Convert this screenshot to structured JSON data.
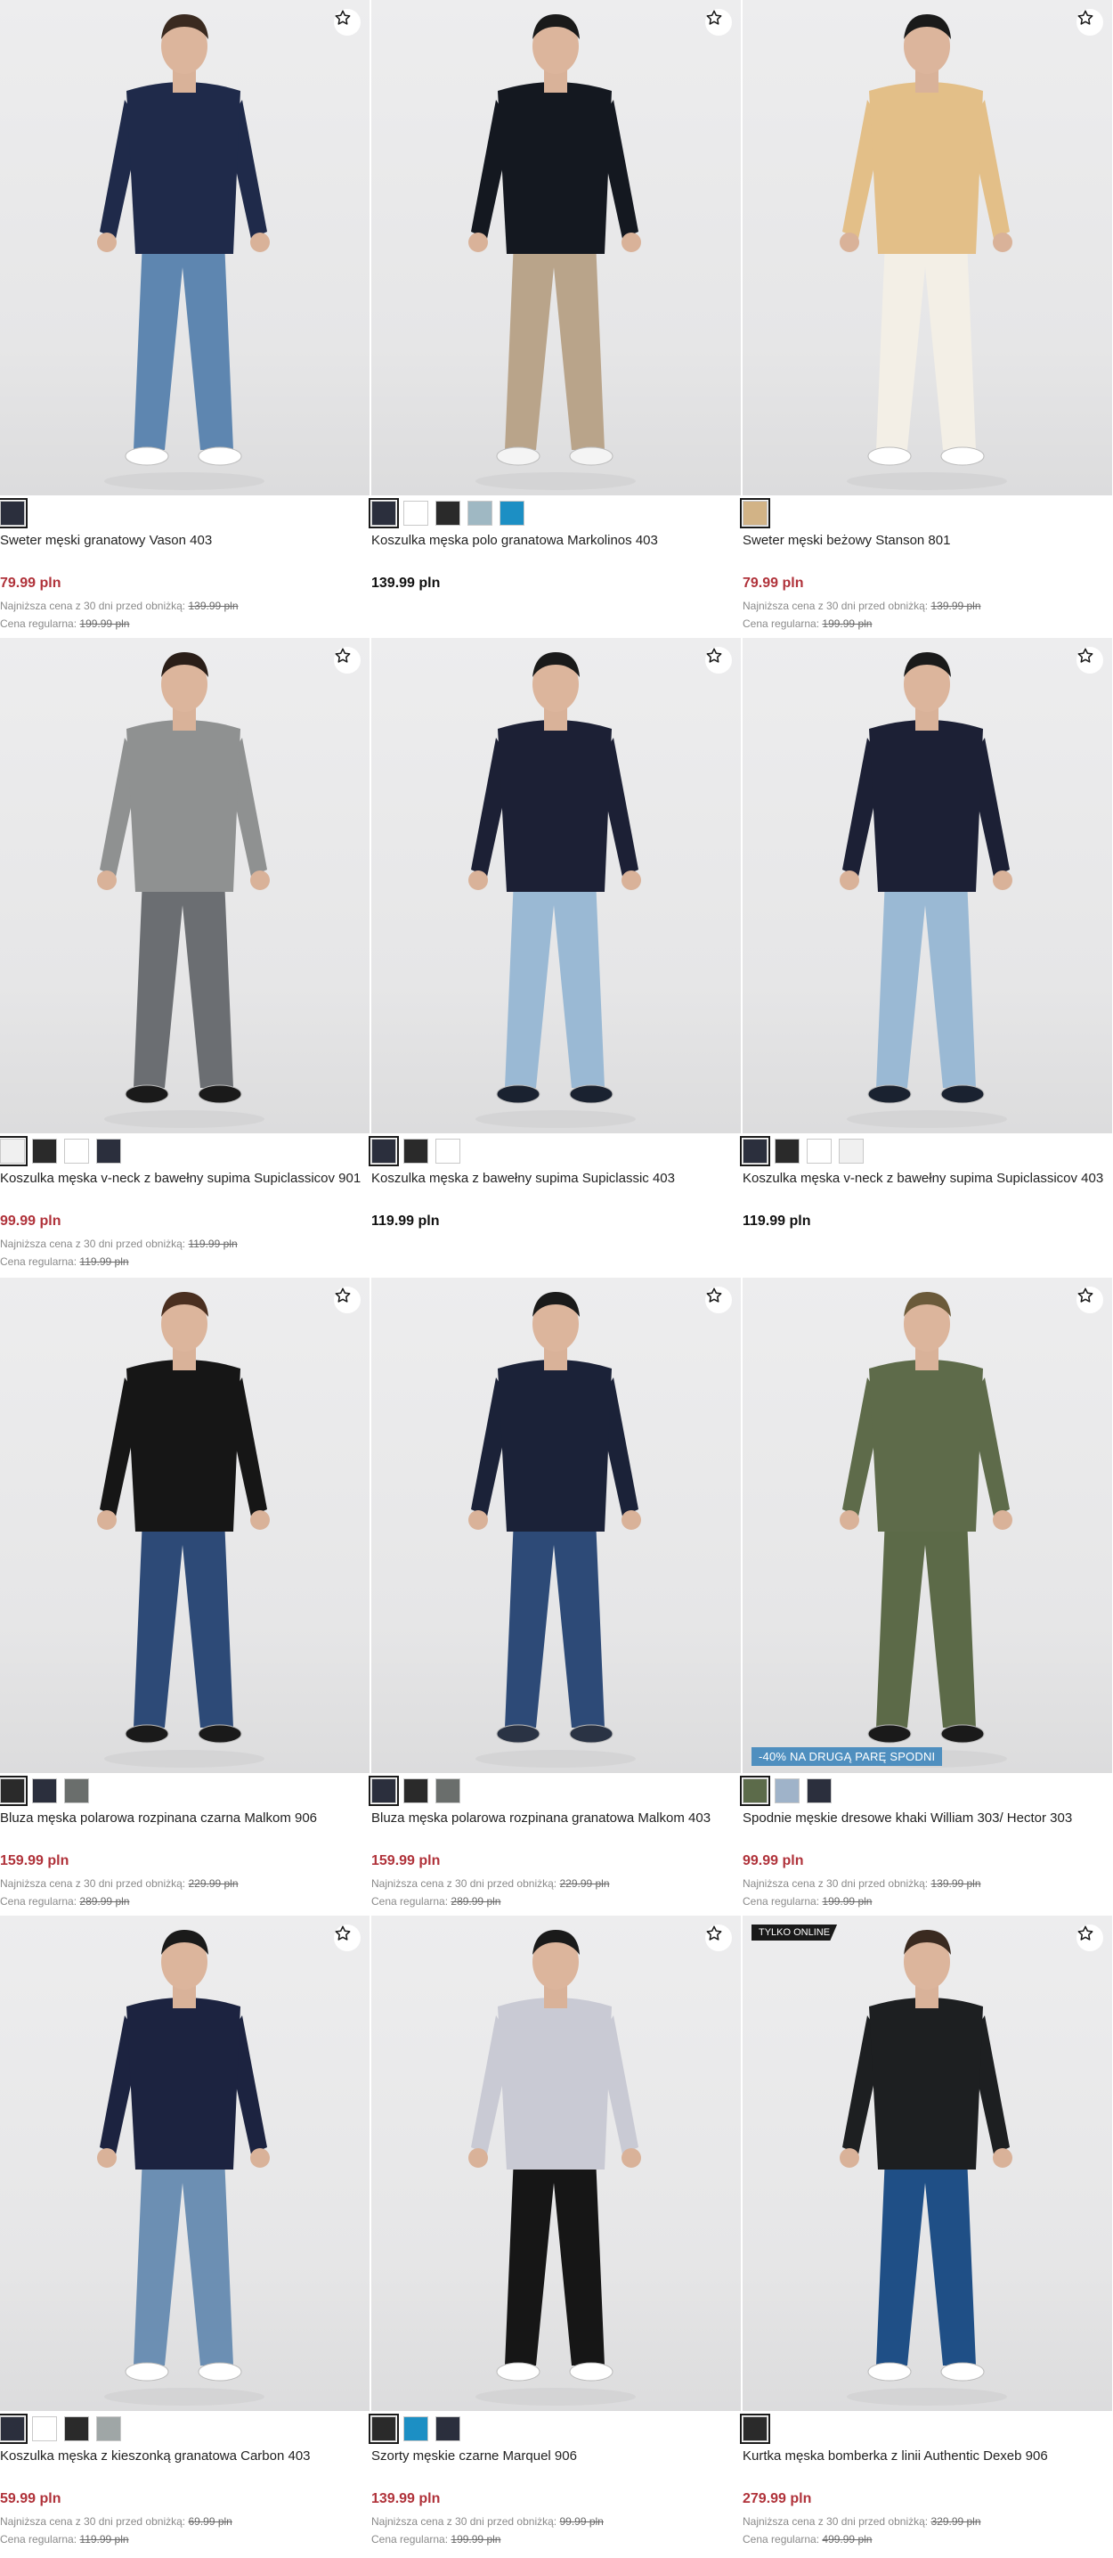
{
  "products": [
    {
      "name": "Sweter męski granatowy Vason 403",
      "price": "79.99 pln",
      "sale": true,
      "lowest_label": "Najniższa cena z 30 dni przed obniżką:",
      "lowest_value": "139.99 pln",
      "regular_label": "Cena regularna:",
      "regular_value": "199.99 pln",
      "swatches": [
        "#2b2f3d"
      ],
      "figure": {
        "top": "#1f2a4a",
        "bottom": "#5e86b0",
        "shoe": "#ffffff",
        "hair": "#3a2a20"
      }
    },
    {
      "name": "Koszulka męska polo granatowa Markolinos 403",
      "price": "139.99 pln",
      "sale": false,
      "swatches": [
        "#2b2f3d",
        "#ffffff",
        "#2a2a2a",
        "#9fb8c3",
        "#1c8fc4"
      ],
      "figure": {
        "top": "#141820",
        "bottom": "#b9a48a",
        "shoe": "#f4f4f4",
        "hair": "#1a1a1a"
      }
    },
    {
      "name": "Sweter męski beżowy Stanson 801",
      "price": "79.99 pln",
      "sale": true,
      "lowest_label": "Najniższa cena z 30 dni przed obniżką:",
      "lowest_value": "139.99 pln",
      "regular_label": "Cena regularna:",
      "regular_value": "199.99 pln",
      "swatches": [
        "#d2b386"
      ],
      "figure": {
        "top": "#e3bf88",
        "bottom": "#f3efe6",
        "shoe": "#ffffff",
        "hair": "#1a1a1a"
      }
    },
    {
      "name": "Koszulka męska v-neck z bawełny supima Supiclassicov 901",
      "price": "99.99 pln",
      "sale": true,
      "lowest_label": "Najniższa cena z 30 dni przed obniżką:",
      "lowest_value": "119.99 pln",
      "regular_label": "Cena regularna:",
      "regular_value": "119.99 pln",
      "swatches": [
        "#f0f0f0",
        "#2a2a2a",
        "#ffffff",
        "#2b2f3d"
      ],
      "figure": {
        "top": "#8f9191",
        "bottom": "#6b6e72",
        "shoe": "#1a1a1a",
        "hair": "#2a1e18"
      }
    },
    {
      "name": "Koszulka męska z bawełny supima Supiclassic 403",
      "price": "119.99 pln",
      "sale": false,
      "swatches": [
        "#2b2f3d",
        "#2a2a2a",
        "#ffffff"
      ],
      "figure": {
        "top": "#1c2035",
        "bottom": "#9ab9d4",
        "shoe": "#1a2230",
        "hair": "#1a1a1a"
      }
    },
    {
      "name": "Koszulka męska v-neck z bawełny supima Supiclassicov 403",
      "price": "119.99 pln",
      "sale": false,
      "swatches": [
        "#2b2f3d",
        "#2a2a2a",
        "#ffffff",
        "#f0f0f0"
      ],
      "figure": {
        "top": "#1c2035",
        "bottom": "#9ab9d4",
        "shoe": "#1a2230",
        "hair": "#1a1a1a"
      }
    },
    {
      "name": "Bluza męska polarowa rozpinana czarna Malkom 906",
      "price": "159.99 pln",
      "sale": true,
      "lowest_label": "Najniższa cena z 30 dni przed obniżką:",
      "lowest_value": "229.99 pln",
      "regular_label": "Cena regularna:",
      "regular_value": "289.99 pln",
      "swatches": [
        "#2a2a2a",
        "#2b2f3d",
        "#6a6e6c"
      ],
      "figure": {
        "top": "#161616",
        "bottom": "#2d4a77",
        "shoe": "#1a1a1a",
        "hair": "#4a2f20"
      }
    },
    {
      "name": "Bluza męska polarowa rozpinana granatowa Malkom 403",
      "price": "159.99 pln",
      "sale": true,
      "lowest_label": "Najniższa cena z 30 dni przed obniżką:",
      "lowest_value": "229.99 pln",
      "regular_label": "Cena regularna:",
      "regular_value": "289.99 pln",
      "swatches": [
        "#2b2f3d",
        "#2a2a2a",
        "#6a6e6c"
      ],
      "figure": {
        "top": "#1b2238",
        "bottom": "#2d4a77",
        "shoe": "#2a3344",
        "hair": "#1a1a1a"
      }
    },
    {
      "name": "Spodnie męskie dresowe khaki William 303/ Hector 303",
      "price": "99.99 pln",
      "sale": true,
      "lowest_label": "Najniższa cena z 30 dni przed obniżką:",
      "lowest_value": "139.99 pln",
      "regular_label": "Cena regularna:",
      "regular_value": "199.99 pln",
      "badge": "-40% NA DRUGĄ PARĘ SPODNI",
      "swatches": [
        "#5c6b4a",
        "#9fb3c9",
        "#2b2f3d"
      ],
      "figure": {
        "top": "#5e6b4a",
        "bottom": "#5c6a48",
        "shoe": "#1a1a1a",
        "hair": "#6b5a3a"
      }
    },
    {
      "name": "Koszulka męska z kieszonką granatowa Carbon 403",
      "price": "59.99 pln",
      "sale": true,
      "lowest_label": "Najniższa cena z 30 dni przed obniżką:",
      "lowest_value": "69.99 pln",
      "regular_label": "Cena regularna:",
      "regular_value": "119.99 pln",
      "swatches": [
        "#2b2f3d",
        "#ffffff",
        "#2a2a2a",
        "#9fa6a6"
      ],
      "figure": {
        "top": "#1c2340",
        "bottom": "#6c8fb3",
        "shoe": "#ffffff",
        "hair": "#1a1a1a"
      }
    },
    {
      "name": "Szorty męskie czarne Marquel 906",
      "price": "139.99 pln",
      "sale": true,
      "lowest_label": "Najniższa cena z 30 dni przed obniżką:",
      "lowest_value": "99.99 pln",
      "regular_label": "Cena regularna:",
      "regular_value": "199.99 pln",
      "swatches": [
        "#2a2a2a",
        "#1c8fc4",
        "#2b2f3d"
      ],
      "figure": {
        "top": "#c9cad4",
        "bottom": "#161616",
        "shoe": "#ffffff",
        "hair": "#1a1a1a"
      }
    },
    {
      "name": "Kurtka męska bomberka z linii Authentic Dexeb 906",
      "price": "279.99 pln",
      "sale": true,
      "lowest_label": "Najniższa cena z 30 dni przed obniżką:",
      "lowest_value": "329.99 pln",
      "regular_label": "Cena regularna:",
      "regular_value": "499.99 pln",
      "top_badge": "TYLKO ONLINE",
      "swatches": [
        "#2a2a2a"
      ],
      "figure": {
        "top": "#1d1f21",
        "bottom": "#1f4f86",
        "shoe": "#ffffff",
        "hair": "#3a2a20"
      }
    }
  ]
}
